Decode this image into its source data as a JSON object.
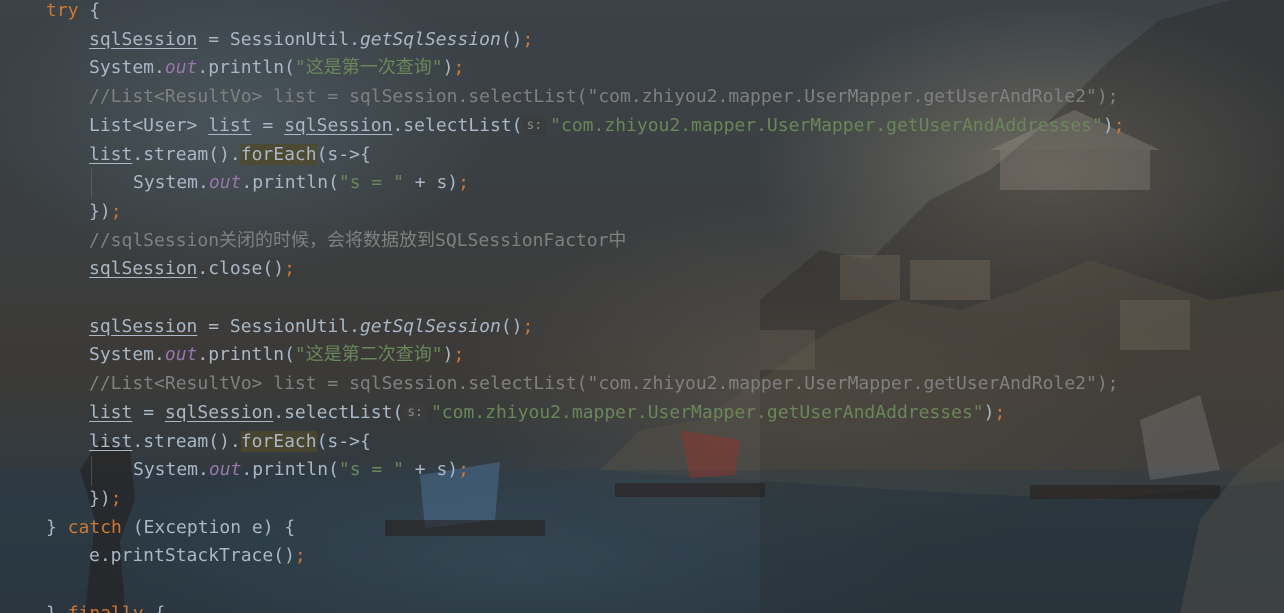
{
  "colors": {
    "keyword": "#cc7832",
    "field": "#9876aa",
    "string": "#6a8759",
    "comment": "#808080",
    "text": "#a9b7c6"
  },
  "lines": [
    [
      {
        "t": "try",
        "c": "kw"
      },
      {
        "t": " {"
      }
    ],
    [
      {
        "t": "sqlSession",
        "c": "var"
      },
      {
        "t": " = SessionUtil."
      },
      {
        "t": "getSqlSession",
        "c": "mth"
      },
      {
        "t": "()"
      },
      {
        "t": ";",
        "c": "kw"
      }
    ],
    [
      {
        "t": "System."
      },
      {
        "t": "out",
        "c": "fld"
      },
      {
        "t": ".println("
      },
      {
        "t": "\"这是第一次查询\"",
        "c": "str"
      },
      {
        "t": ")"
      },
      {
        "t": ";",
        "c": "kw"
      }
    ],
    [
      {
        "t": "//List<ResultVo> list = sqlSession.selectList(\"com.zhiyou2.mapper.UserMapper.getUserAndRole2\");",
        "c": "cmt"
      }
    ],
    [
      {
        "t": "List<User> "
      },
      {
        "t": "list",
        "c": "var"
      },
      {
        "t": " = "
      },
      {
        "t": "sqlSession",
        "c": "var"
      },
      {
        "t": ".selectList("
      },
      {
        "t": "s:",
        "c": "hint"
      },
      {
        "t": "\"com.zhiyou2.mapper.UserMapper.getUserAndAddresses\"",
        "c": "str"
      },
      {
        "t": ")"
      },
      {
        "t": ";",
        "c": "kw"
      }
    ],
    [
      {
        "t": "list",
        "c": "var"
      },
      {
        "t": ".stream()."
      },
      {
        "t": "forEach",
        "c": "hl"
      },
      {
        "t": "(s->{"
      }
    ],
    [
      {
        "t": "System."
      },
      {
        "t": "out",
        "c": "fld"
      },
      {
        "t": ".println("
      },
      {
        "t": "\"s = \"",
        "c": "str"
      },
      {
        "t": " + s)"
      },
      {
        "t": ";",
        "c": "kw"
      }
    ],
    [
      {
        "t": "})"
      },
      {
        "t": ";",
        "c": "kw"
      }
    ],
    [
      {
        "t": "//sqlSession关闭的时候，会将数据放到SQLSessionFactor中",
        "c": "cmt"
      }
    ],
    [
      {
        "t": "sqlSession",
        "c": "var"
      },
      {
        "t": ".close()"
      },
      {
        "t": ";",
        "c": "kw"
      }
    ],
    [],
    [
      {
        "t": "sqlSession",
        "c": "var"
      },
      {
        "t": " = SessionUtil."
      },
      {
        "t": "getSqlSession",
        "c": "mth"
      },
      {
        "t": "()"
      },
      {
        "t": ";",
        "c": "kw"
      }
    ],
    [
      {
        "t": "System."
      },
      {
        "t": "out",
        "c": "fld"
      },
      {
        "t": ".println("
      },
      {
        "t": "\"这是第二次查询\"",
        "c": "str"
      },
      {
        "t": ")"
      },
      {
        "t": ";",
        "c": "kw"
      }
    ],
    [
      {
        "t": "//List<ResultVo> list = sqlSession.selectList(\"com.zhiyou2.mapper.UserMapper.getUserAndRole2\");",
        "c": "cmt"
      }
    ],
    [
      {
        "t": "list",
        "c": "var"
      },
      {
        "t": " = "
      },
      {
        "t": "sqlSession",
        "c": "var"
      },
      {
        "t": ".selectList("
      },
      {
        "t": "s:",
        "c": "hint"
      },
      {
        "t": "\"com.zhiyou2.mapper.UserMapper.getUserAndAddresses\"",
        "c": "str"
      },
      {
        "t": ")"
      },
      {
        "t": ";",
        "c": "kw"
      }
    ],
    [
      {
        "t": "list",
        "c": "var"
      },
      {
        "t": ".stream()."
      },
      {
        "t": "forEach",
        "c": "hl"
      },
      {
        "t": "(s->{"
      }
    ],
    [
      {
        "t": "System."
      },
      {
        "t": "out",
        "c": "fld"
      },
      {
        "t": ".println("
      },
      {
        "t": "\"s = \"",
        "c": "str"
      },
      {
        "t": " + s)"
      },
      {
        "t": ";",
        "c": "kw"
      }
    ],
    [
      {
        "t": "})"
      },
      {
        "t": ";",
        "c": "kw"
      }
    ],
    [
      {
        "t": "} "
      },
      {
        "t": "catch",
        "c": "kw"
      },
      {
        "t": " (Exception e) {"
      }
    ],
    [
      {
        "t": "e.printStackTrace()"
      },
      {
        "t": ";",
        "c": "kw"
      }
    ],
    [],
    [
      {
        "t": "} "
      },
      {
        "t": "finally",
        "c": "kw"
      },
      {
        "t": " {"
      }
    ]
  ]
}
